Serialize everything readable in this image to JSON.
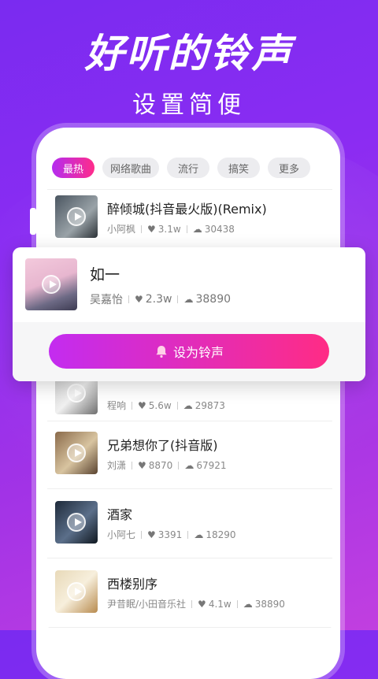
{
  "promo": {
    "headline": "好听的铃声",
    "subhead": "设置简便"
  },
  "tabs": [
    "最热",
    "网络歌曲",
    "流行",
    "搞笑",
    "更多"
  ],
  "active_tab": "最热",
  "songs": [
    {
      "title": "醉倾城(抖音最火版)(Remix)",
      "artist": "小阿枫",
      "likes": "3.1w",
      "downloads": "30438"
    },
    {
      "title": "",
      "artist": "程响",
      "likes": "5.6w",
      "downloads": "29873"
    },
    {
      "title": "兄弟想你了(抖音版)",
      "artist": "刘潇",
      "likes": "8870",
      "downloads": "67921"
    },
    {
      "title": "酒家",
      "artist": "小阿七",
      "likes": "3391",
      "downloads": "18290"
    },
    {
      "title": "西楼别序",
      "artist": "尹昔眠/小田音乐社",
      "likes": "4.1w",
      "downloads": "38890"
    }
  ],
  "selected": {
    "title": "如一",
    "artist": "吴嘉怡",
    "likes": "2.3w",
    "downloads": "38890",
    "button": "设为铃声"
  },
  "icons": {
    "like": "heart-icon",
    "download": "cloud-download-icon",
    "play": "play-icon",
    "bell": "bell-icon"
  },
  "colors": {
    "accent_start": "#c32cf0",
    "accent_end": "#ff2c85",
    "bg_top": "#7a2bf0",
    "bg_bottom": "#c13fe0"
  }
}
